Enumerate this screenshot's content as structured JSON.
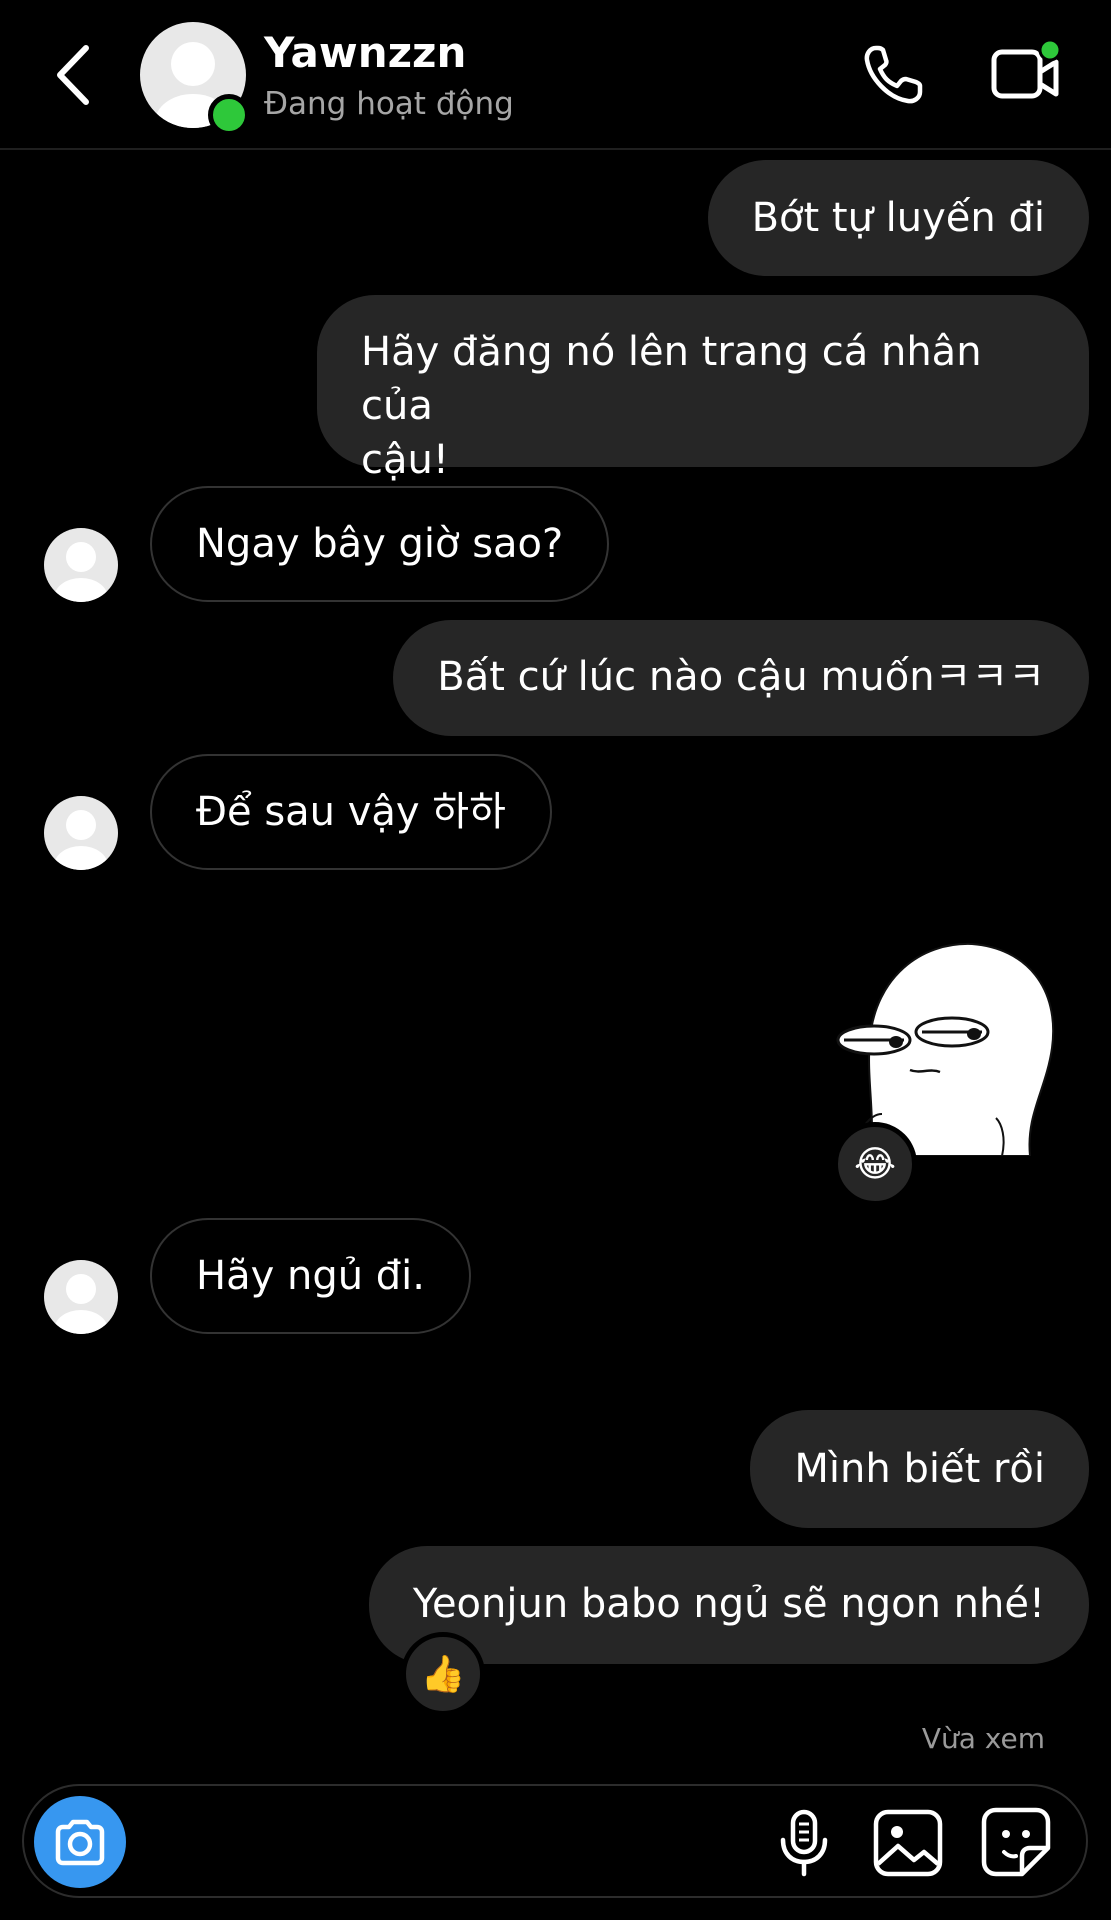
{
  "header": {
    "contact_name": "Yawnzzn",
    "status_text": "Đang hoạt động"
  },
  "messages": [
    {
      "side": "out",
      "text": "Bớt tự luyến đi"
    },
    {
      "side": "out",
      "text_line1": "Hãy đăng nó lên trang cá nhân của",
      "text_line2": "cậu!"
    },
    {
      "side": "in",
      "text": "Ngay bây giờ sao?"
    },
    {
      "side": "out",
      "text": "Bất cứ lúc nào cậu muốnㅋㅋㅋ"
    },
    {
      "side": "in",
      "text": "Để sau vậy 하하"
    },
    {
      "side": "out",
      "type": "sticker",
      "reaction": "😂"
    },
    {
      "side": "in",
      "text": "Hãy ngủ đi."
    },
    {
      "side": "out",
      "text": "Mình biết rồi"
    },
    {
      "side": "out",
      "text": "Yeonjun babo ngủ sẽ ngon nhé!",
      "reaction": "👍"
    }
  ],
  "seen_text": "Vừa xem",
  "icons": {
    "back": "chevron-left-icon",
    "call": "phone-icon",
    "video": "video-camera-icon",
    "camera": "camera-icon",
    "mic": "microphone-icon",
    "gallery": "image-icon",
    "sticker": "sticker-icon"
  },
  "colors": {
    "background": "#000000",
    "bubble_out": "#262626",
    "online": "#2ec83a",
    "camera_button": "#3797f0"
  }
}
